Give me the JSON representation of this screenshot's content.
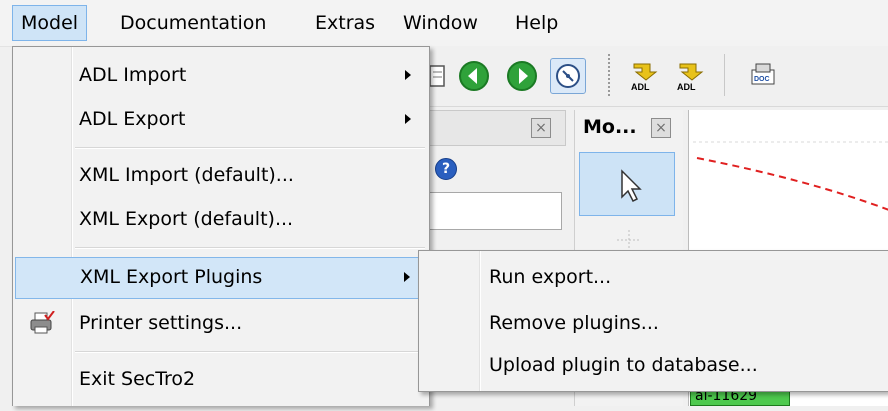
{
  "menubar": {
    "items": [
      "Model",
      "Documentation",
      "Extras",
      "Window",
      "Help"
    ]
  },
  "background": {
    "mo_panel_title": "Mo...",
    "green_label": "al-11629"
  },
  "model_menu": {
    "items": [
      {
        "label": "ADL Import",
        "submenu": true
      },
      {
        "label": "ADL Export",
        "submenu": true
      },
      {
        "label": "XML Import (default)..."
      },
      {
        "label": "XML Export (default)..."
      },
      {
        "label": "XML Export Plugins",
        "submenu": true,
        "highlighted": true
      },
      {
        "label": "Printer settings...",
        "icon": "printer-icon"
      },
      {
        "label": "Exit SecTro2"
      }
    ]
  },
  "plugins_submenu": {
    "items": [
      {
        "label": "Run export..."
      },
      {
        "label": "Remove plugins..."
      },
      {
        "label": "Upload plugin to database..."
      }
    ]
  },
  "colors": {
    "highlight": "#d2e6f8",
    "highlight_border": "#83b7ea",
    "accent_green": "#2fa23a"
  }
}
